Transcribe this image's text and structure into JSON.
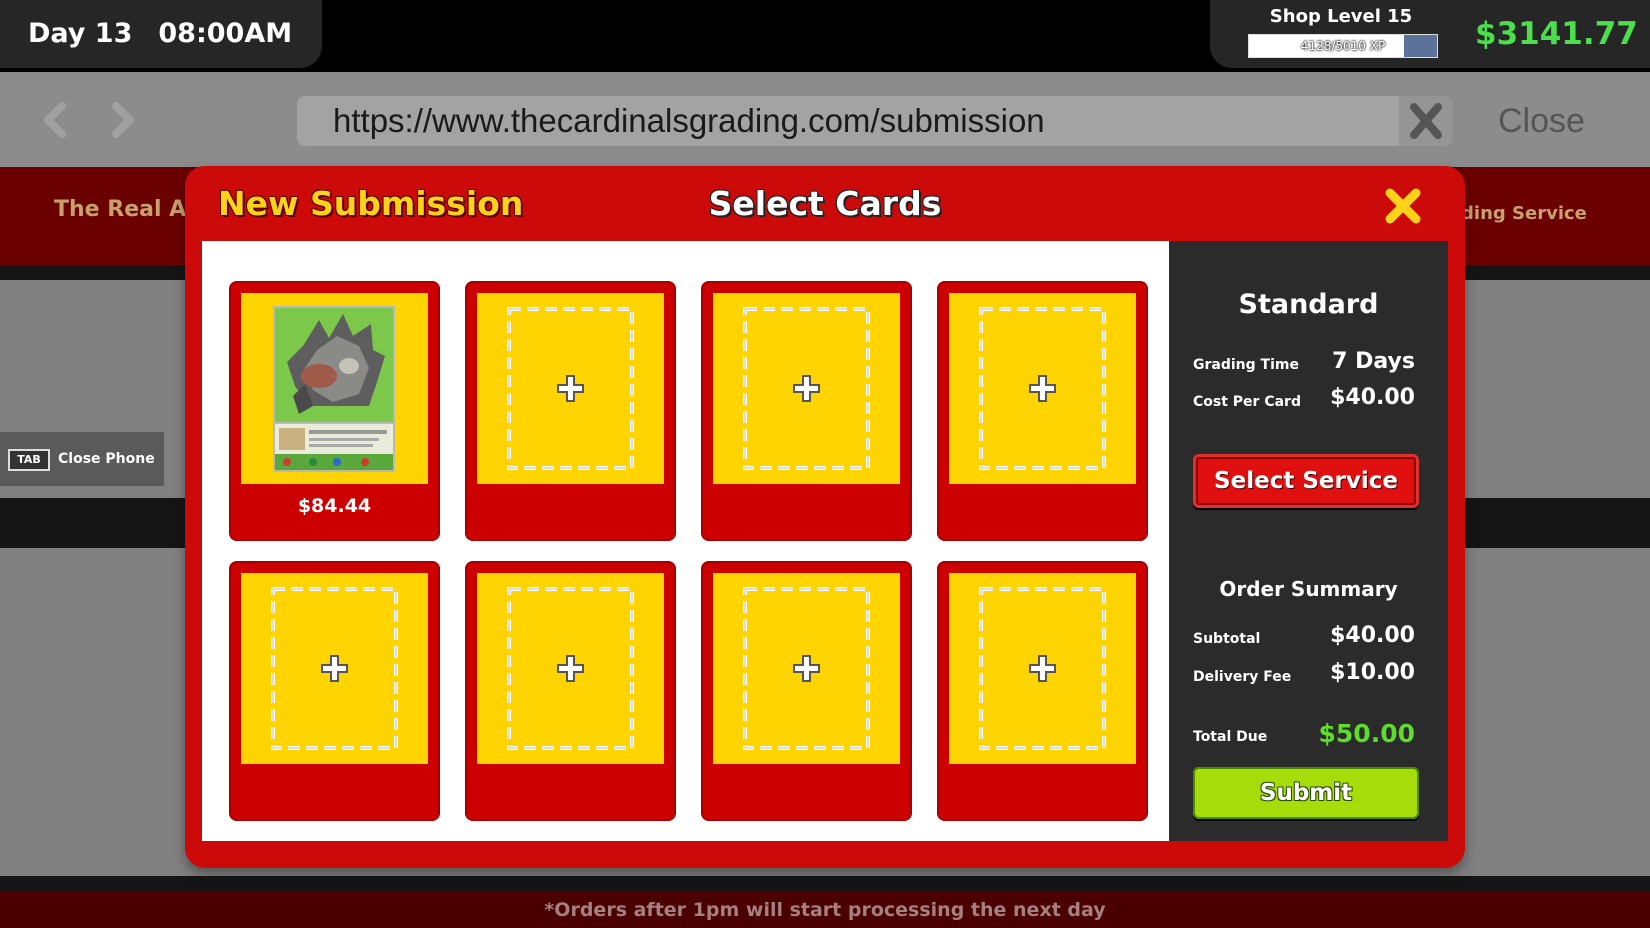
{
  "hud": {
    "day": "Day 13",
    "time": "08:00AM",
    "shop_level": "Shop Level 15",
    "xp_text": "4128/5010 XP",
    "xp_progress": 0.824,
    "money": "$3141.77"
  },
  "browser": {
    "back_icon": "chevron-left-icon",
    "forward_icon": "chevron-right-icon",
    "url": "https://www.thecardinalsgrading.com/submission",
    "clear_icon": "x-icon",
    "close_label": "Close"
  },
  "background_page": {
    "site_name_left": "The Real Au",
    "site_name_right": "rading Service",
    "footer_note": "*Orders after 1pm will start processing the next day"
  },
  "phone_hint": {
    "key": "TAB",
    "label": "Close Phone"
  },
  "modal": {
    "title": "New Submission",
    "subtitle": "Select Cards",
    "close_icon": "x-icon",
    "slots": [
      {
        "filled": true,
        "price": "$84.44"
      },
      {
        "filled": false,
        "price": ""
      },
      {
        "filled": false,
        "price": ""
      },
      {
        "filled": false,
        "price": ""
      },
      {
        "filled": false,
        "price": ""
      },
      {
        "filled": false,
        "price": ""
      },
      {
        "filled": false,
        "price": ""
      },
      {
        "filled": false,
        "price": ""
      }
    ],
    "service": {
      "tier": "Standard",
      "grading_time_label": "Grading Time",
      "grading_time_value": "7 Days",
      "cost_label": "Cost Per Card",
      "cost_value": "$40.00",
      "select_button": "Select Service"
    },
    "summary": {
      "title": "Order Summary",
      "subtotal_label": "Subtotal",
      "subtotal_value": "$40.00",
      "delivery_label": "Delivery Fee",
      "delivery_value": "$10.00",
      "total_label": "Total Due",
      "total_value": "$50.00",
      "submit_button": "Submit"
    }
  },
  "colors": {
    "accent_red": "#cc0a0a",
    "slot_yellow": "#ffd400",
    "money_green": "#4be04b",
    "submit_green": "#a6dc0a",
    "title_yellow": "#ffd21a"
  }
}
